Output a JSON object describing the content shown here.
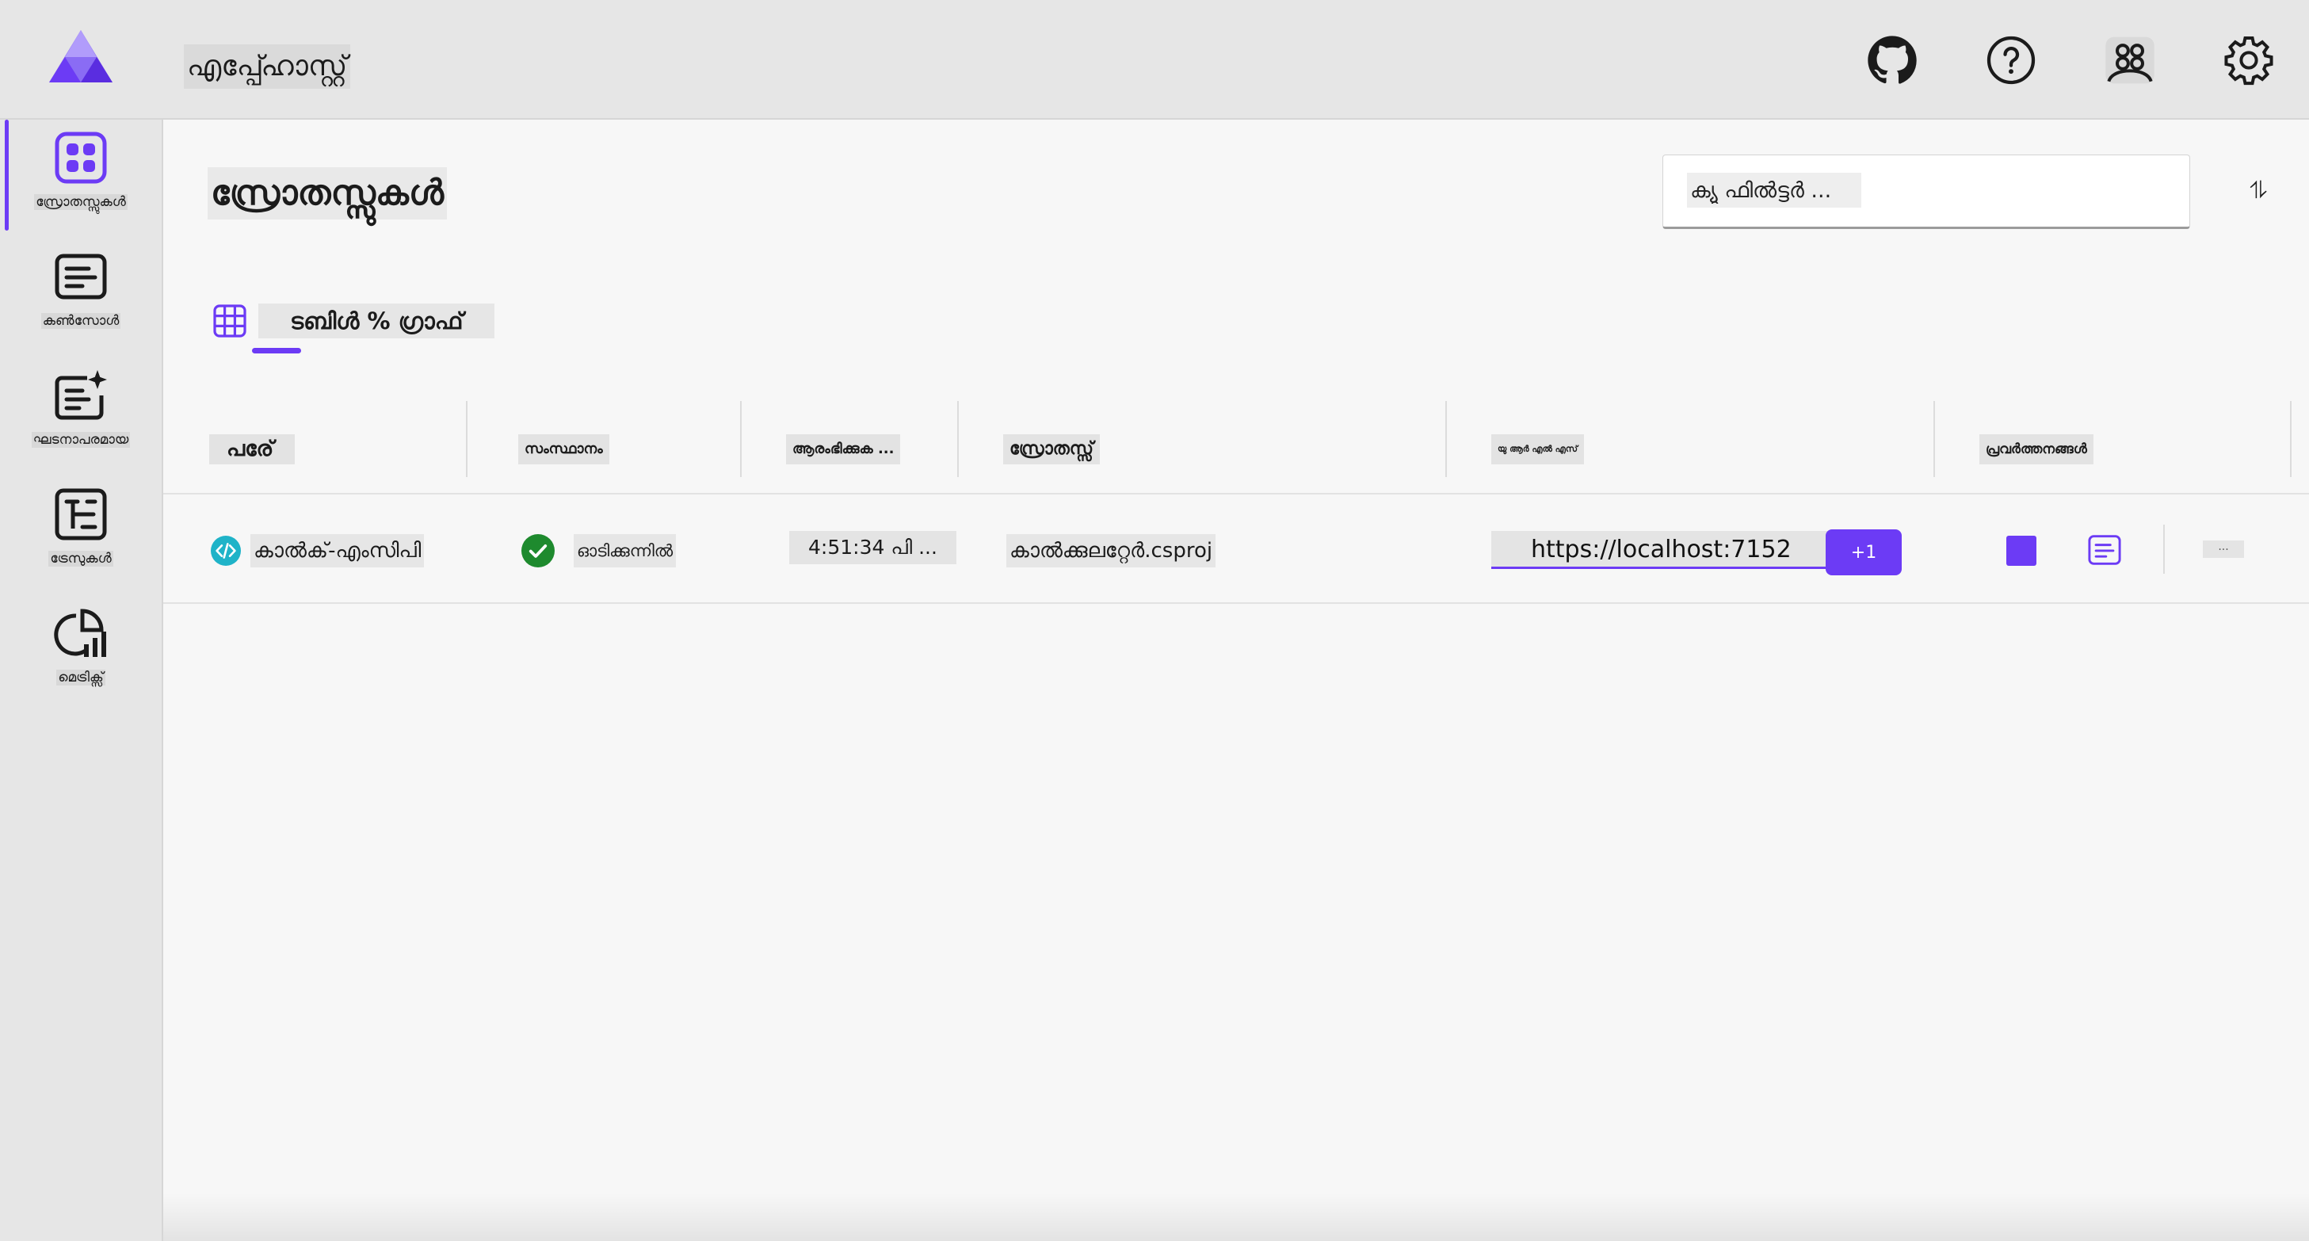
{
  "app": {
    "title": "എപ്പ്ഹോസ്റ്റ്"
  },
  "header": {
    "buttons": [
      {
        "name": "github",
        "icon": "github-icon"
      },
      {
        "name": "help",
        "icon": "help-icon"
      },
      {
        "name": "account",
        "icon": "account-icon"
      },
      {
        "name": "settings",
        "icon": "gear-icon"
      }
    ]
  },
  "sidebar": {
    "items": [
      {
        "label": "സ്രോതസ്സുകൾ",
        "icon": "grid-icon",
        "active": true
      },
      {
        "label": "കൺസോൾ",
        "icon": "console-icon",
        "active": false
      },
      {
        "label": "ഘടനാപരമായ",
        "icon": "structured-logs-icon",
        "active": false
      },
      {
        "label": "ട്രേസുകൾ",
        "icon": "traces-icon",
        "active": false
      },
      {
        "label": "മെട്രിക്സ്",
        "icon": "metrics-icon",
        "active": false
      }
    ]
  },
  "main": {
    "title": "സ്രോതസ്സുകൾ",
    "filter": {
      "placeholder": "ക്യു ഫിൽട്ടർ ..."
    },
    "filter_toggle": "⥮",
    "tab": {
      "label": "ടബിൾ % ഗ്രാഫ്"
    },
    "table": {
      "headers": [
        "പരേ്",
        "സംസ്ഥാനം",
        "ആരംഭിക്കുക ...",
        "സ്രോതസ്സ്",
        "യു ആർ എൽ എസ്",
        "പ്രവർത്തനങ്ങൾ"
      ],
      "rows": [
        {
          "name": "കാൽക്-എംസിപി",
          "state": "ഓടിക്കുന്നിൽ",
          "start": "4:51:34 പി ...",
          "source": "കാൽക്കുലറ്റേർ.csproj",
          "url": "https://localhost:7152",
          "more_urls": "+1",
          "more": "..."
        }
      ]
    }
  },
  "colors": {
    "accent": "#6c3bf5",
    "running": "#1e8a2e",
    "resource": "#1fb3c8"
  }
}
